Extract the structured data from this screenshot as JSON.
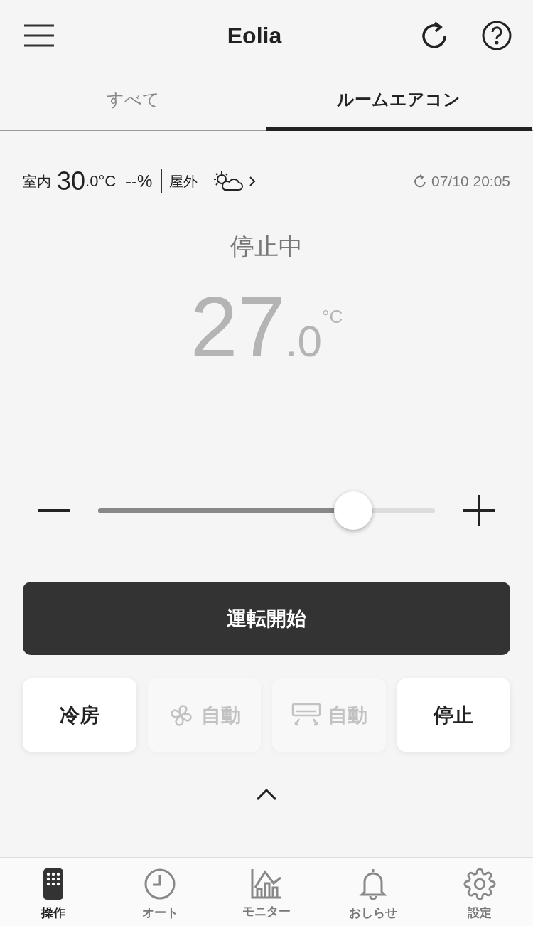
{
  "header": {
    "title": "Eolia"
  },
  "tabs": [
    {
      "label": "すべて",
      "selected": false
    },
    {
      "label": "ルームエアコン",
      "selected": true
    }
  ],
  "info": {
    "indoor_label": "室内",
    "indoor_temp_whole": "30",
    "indoor_temp_fraction": ".0°C",
    "humidity": "--%",
    "outdoor_label": "屋外",
    "updated": "07/10 20:05"
  },
  "status": "停止中",
  "set_temp": {
    "whole": "27",
    "fraction": ".0",
    "unit": "°C",
    "disabled": true
  },
  "slider": {
    "level": 0.757
  },
  "start_button": "運転開始",
  "modes": [
    {
      "kind": "text",
      "label": "冷房",
      "disabled": false
    },
    {
      "kind": "fan",
      "label": "自動",
      "disabled": true
    },
    {
      "kind": "louver",
      "label": "自動",
      "disabled": true
    },
    {
      "kind": "text",
      "label": "停止",
      "disabled": false
    }
  ],
  "nav": [
    {
      "kind": "remote",
      "label": "操作",
      "selected": true
    },
    {
      "kind": "clock",
      "label": "オート",
      "selected": false
    },
    {
      "kind": "chart",
      "label": "モニター",
      "selected": false
    },
    {
      "kind": "bell",
      "label": "おしらせ",
      "selected": false
    },
    {
      "kind": "gear",
      "label": "設定",
      "selected": false
    }
  ]
}
